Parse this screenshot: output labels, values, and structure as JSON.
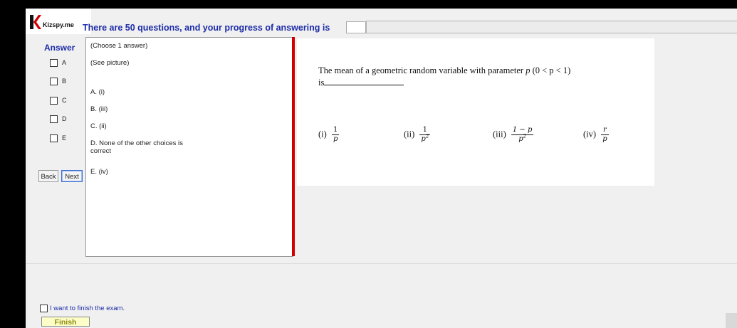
{
  "header": {
    "brand": "Kizspy.me",
    "brand_color": "#d40000",
    "progress_label": "There are 50 questions, and your progress of answering is"
  },
  "answer_panel": {
    "title": "Answer",
    "options": [
      "A",
      "B",
      "C",
      "D",
      "E"
    ]
  },
  "nav": {
    "back_label": "Back",
    "next_label": "Next"
  },
  "choices": {
    "instruction": "(Choose 1 answer)",
    "see_picture": "(See picture)",
    "items": [
      "A. (i)",
      "B. (iii)",
      "C. (ii)",
      "D. None of the other choices is",
      "correct",
      "E. (iv)"
    ]
  },
  "question": {
    "line1_prefix": "The mean of a geometric random variable with parameter",
    "param": "p",
    "condition": "(0 < p < 1)",
    "line2_prefix": "is",
    "alternatives": [
      {
        "label": "(i)",
        "numerator": "1",
        "denominator": "p"
      },
      {
        "label": "(ii)",
        "numerator": "1",
        "denominator": "p",
        "denominator_exp": "2"
      },
      {
        "label": "(iii)",
        "numerator": "1 − p",
        "denominator": "p",
        "denominator_exp": "2"
      },
      {
        "label": "(iv)",
        "numerator": "r",
        "denominator": "p"
      }
    ]
  },
  "footer": {
    "finish_check_label": "I want to finish the exam.",
    "finish_button_label": "Finish"
  }
}
